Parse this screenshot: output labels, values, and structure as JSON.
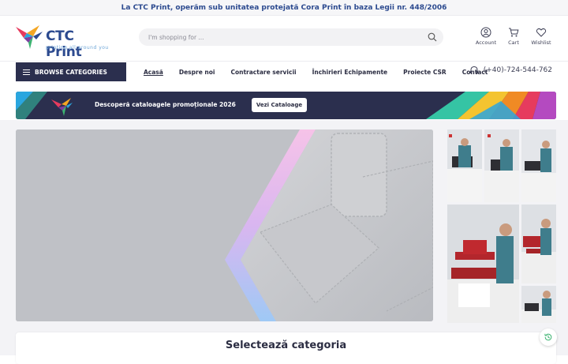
{
  "topbar": {
    "text": "La CTC Print, operăm sub unitatea protejată Cora Print în baza Legii nr. 448/2006"
  },
  "logo": {
    "name": "CTC Print",
    "tagline": "printing all around you"
  },
  "search": {
    "placeholder": "I'm shopping for ..."
  },
  "header_icons": [
    {
      "label": "Account",
      "icon": "user-icon"
    },
    {
      "label": "Cart",
      "icon": "cart-icon"
    },
    {
      "label": "Wishlist",
      "icon": "heart-icon"
    }
  ],
  "nav": {
    "browse_label": "BROWSE CATEGORIES",
    "items": [
      {
        "label": "Acasă",
        "active": true
      },
      {
        "label": "Despre noi"
      },
      {
        "label": "Contractare servicii"
      },
      {
        "label": "Închirieri Echipamente"
      },
      {
        "label": "Proiecte CSR"
      },
      {
        "label": "Contact"
      }
    ],
    "phone": "(+40)-724-544-762"
  },
  "banner": {
    "text": "Descoperă cataloagele promoționale 2026",
    "button_label": "Vezi Cataloage"
  },
  "section": {
    "title": "Selectează categoria"
  },
  "colors": {
    "primary": "#2b2f4e",
    "brand_blue": "#2c4a8f",
    "background": "#f3f3f6"
  }
}
